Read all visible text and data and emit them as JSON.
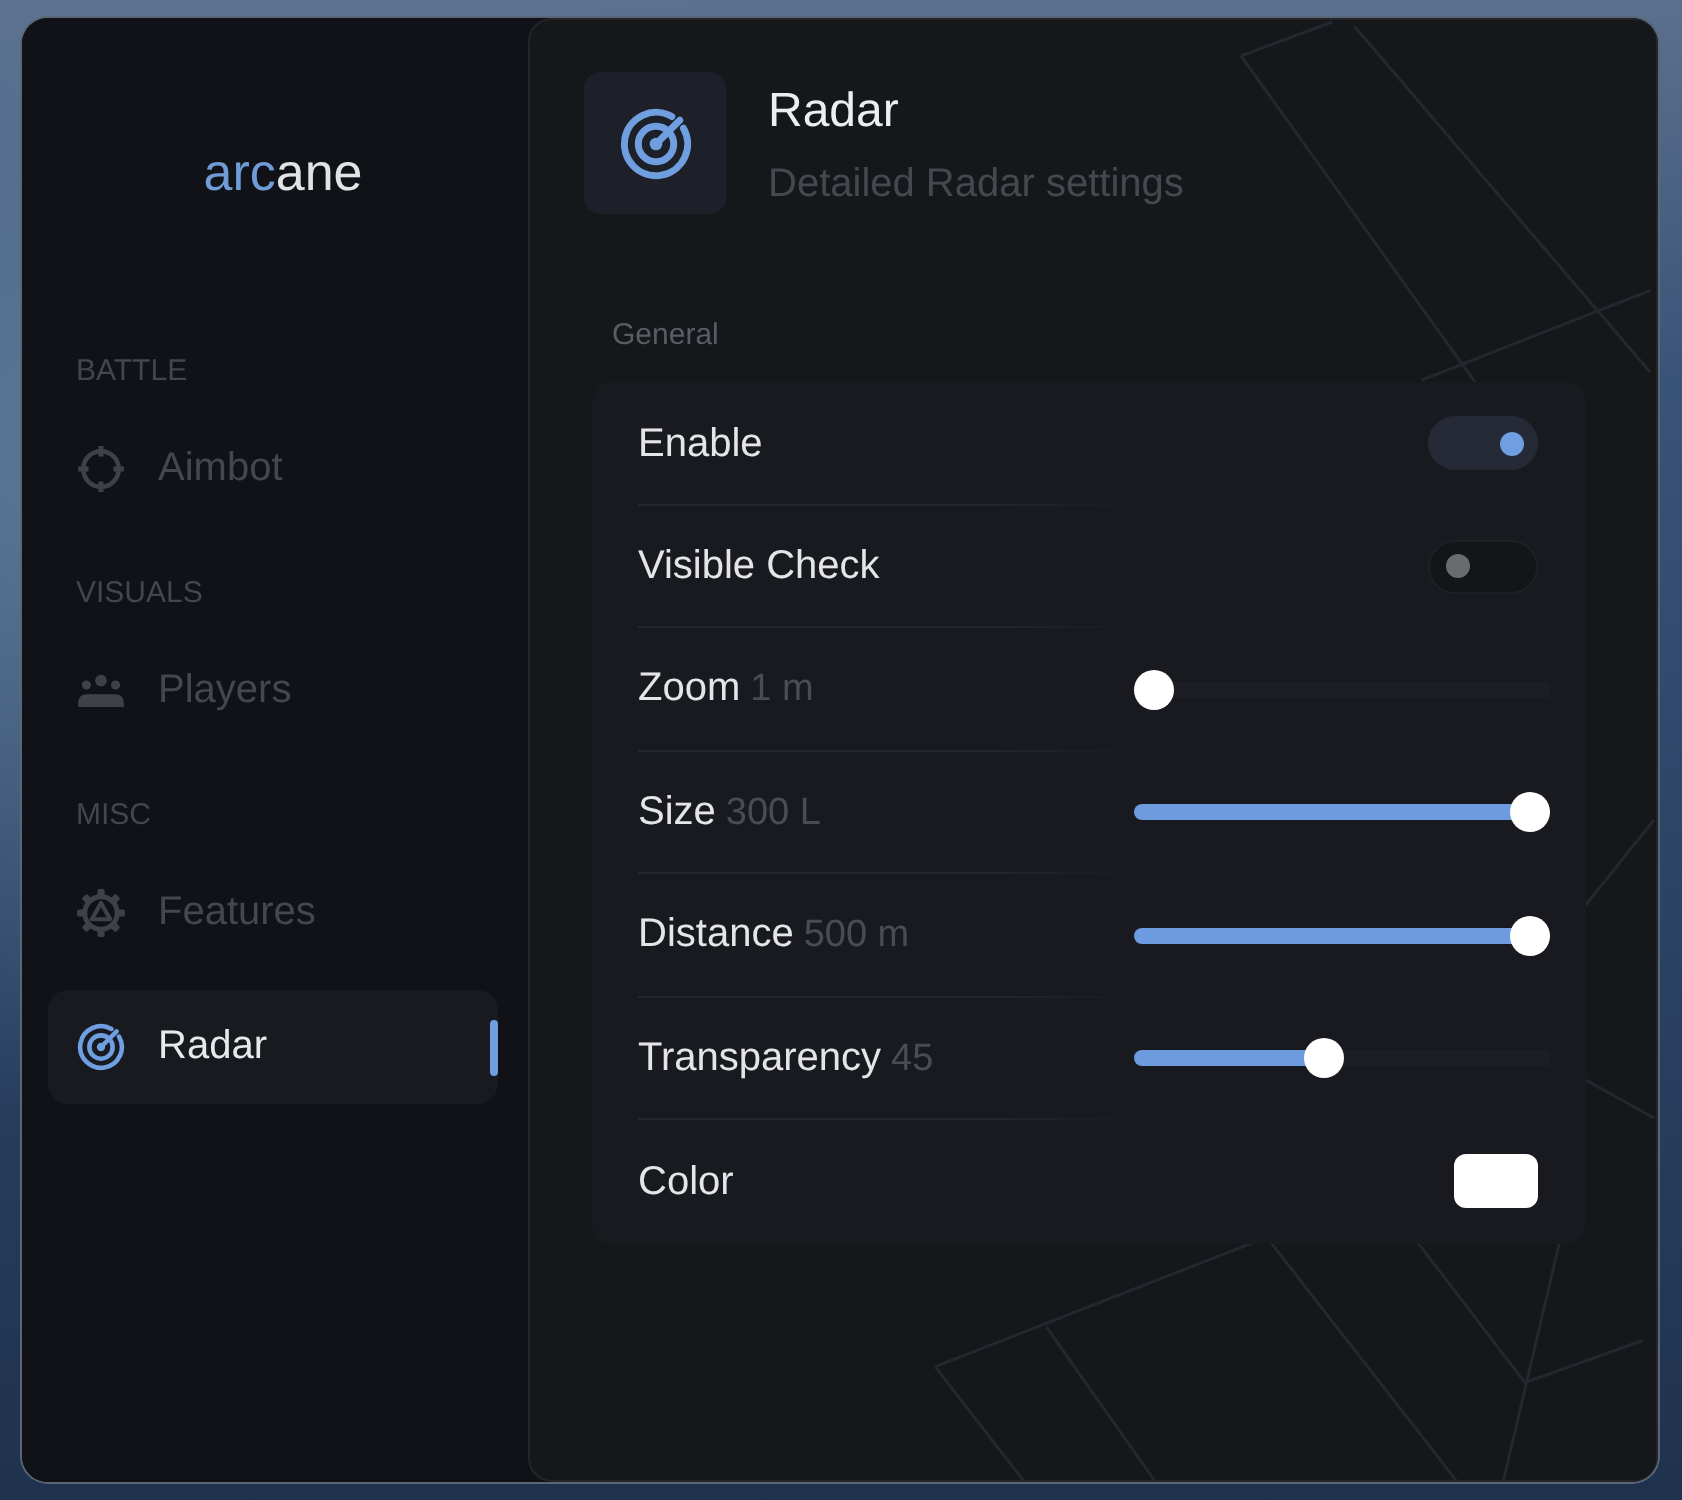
{
  "sidebar": {
    "logo": {
      "accent": "arc",
      "rest": "ane"
    },
    "sections": [
      {
        "label": "BATTLE",
        "items": [
          {
            "label": "Aimbot",
            "selected": false
          }
        ]
      },
      {
        "label": "VISUALS",
        "items": [
          {
            "label": "Players",
            "selected": false
          }
        ]
      },
      {
        "label": "MISC",
        "items": [
          {
            "label": "Features",
            "selected": false
          },
          {
            "label": "Radar",
            "selected": true
          }
        ]
      }
    ]
  },
  "header": {
    "title": "Radar",
    "subtitle": "Detailed Radar settings"
  },
  "group": {
    "label": "General",
    "settings": [
      {
        "kind": "toggle",
        "label": "Enable",
        "on": true
      },
      {
        "kind": "toggle",
        "label": "Visible Check",
        "on": false
      },
      {
        "kind": "slider",
        "label": "Zoom",
        "value": "1 m",
        "level": 0
      },
      {
        "kind": "slider",
        "label": "Size",
        "value": "300 L",
        "level": 1
      },
      {
        "kind": "slider",
        "label": "Distance",
        "value": "500 m",
        "level": 1
      },
      {
        "kind": "slider",
        "label": "Transparency",
        "value": "45",
        "level": 0.45
      },
      {
        "kind": "color",
        "label": "Color",
        "color": "#ffffff"
      }
    ]
  }
}
